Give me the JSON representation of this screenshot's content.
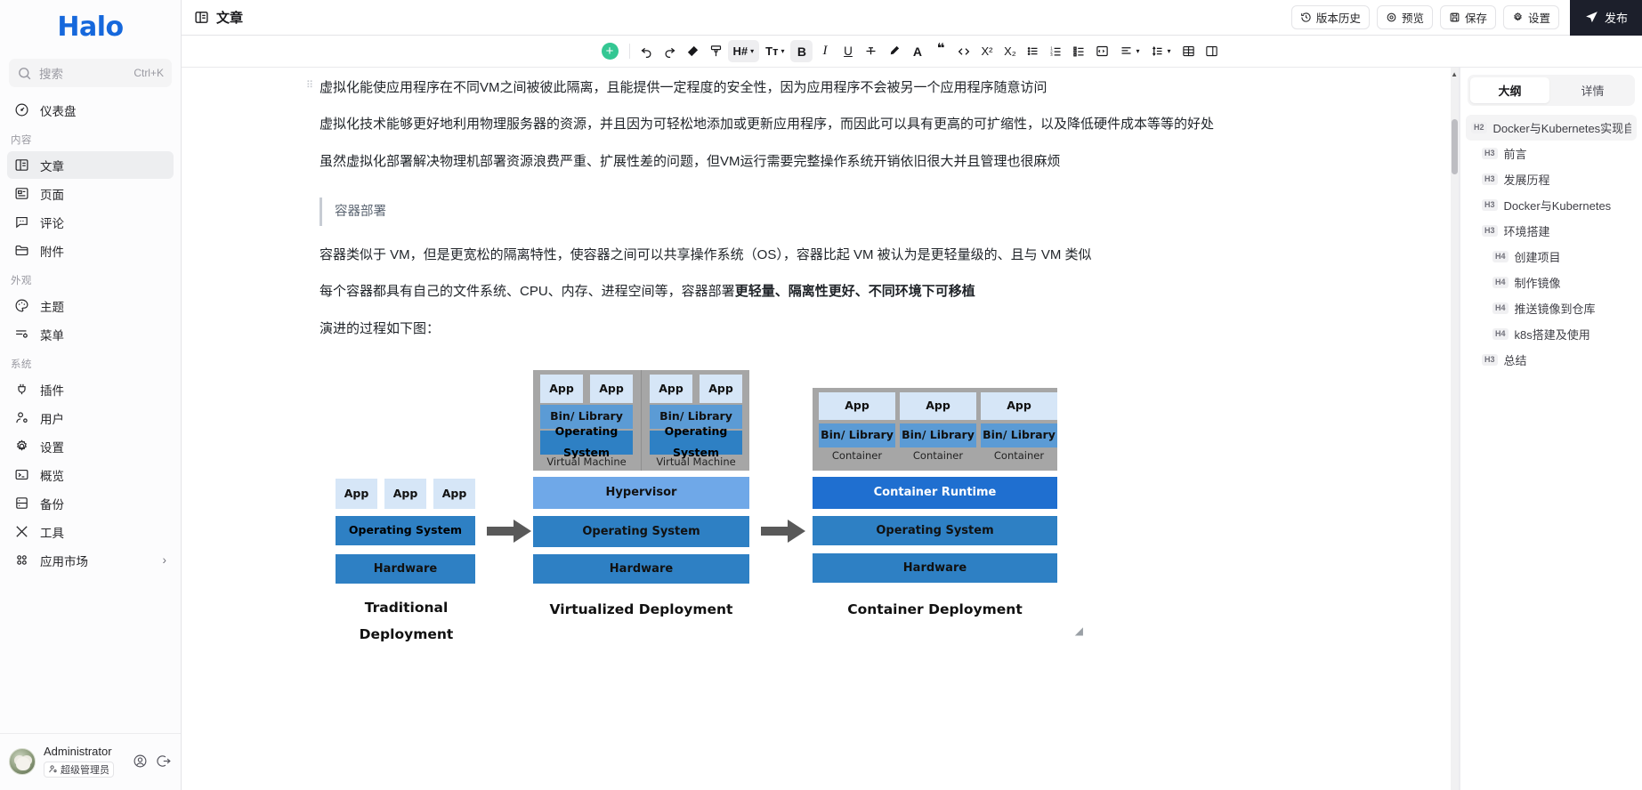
{
  "brand": {
    "name": "Halo"
  },
  "search": {
    "placeholder": "搜索",
    "shortcut": "Ctrl+K"
  },
  "sidebar": {
    "dashboard": {
      "label": "仪表盘",
      "icon": "gauge-icon"
    },
    "groups": [
      {
        "label": "内容",
        "items": [
          {
            "label": "文章",
            "icon": "article-icon",
            "active": true
          },
          {
            "label": "页面",
            "icon": "page-icon",
            "active": false
          },
          {
            "label": "评论",
            "icon": "comment-icon",
            "active": false
          },
          {
            "label": "附件",
            "icon": "folder-icon",
            "active": false
          }
        ]
      },
      {
        "label": "外观",
        "items": [
          {
            "label": "主题",
            "icon": "palette-icon",
            "active": false
          },
          {
            "label": "菜单",
            "icon": "menu-settings-icon",
            "active": false
          }
        ]
      },
      {
        "label": "系统",
        "items": [
          {
            "label": "插件",
            "icon": "plug-icon",
            "active": false
          },
          {
            "label": "用户",
            "icon": "user-gear-icon",
            "active": false
          },
          {
            "label": "设置",
            "icon": "gear-icon",
            "active": false
          },
          {
            "label": "概览",
            "icon": "terminal-icon",
            "active": false
          },
          {
            "label": "备份",
            "icon": "database-icon",
            "active": false
          },
          {
            "label": "工具",
            "icon": "tools-icon",
            "active": false
          },
          {
            "label": "应用市场",
            "icon": "grid-icon",
            "active": false,
            "chevron": "›"
          }
        ]
      }
    ],
    "user": {
      "name": "Administrator",
      "role": "超级管理员",
      "role_icon": "user-role-icon",
      "profile_icon": "user-circle-icon",
      "logout_icon": "logout-icon",
      "avatar_name": "avatar"
    }
  },
  "header": {
    "title": "文章",
    "title_icon": "article-icon",
    "actions": [
      {
        "label": "版本历史",
        "icon": "history-icon"
      },
      {
        "label": "预览",
        "icon": "eye-icon"
      },
      {
        "label": "保存",
        "icon": "save-icon"
      },
      {
        "label": "设置",
        "icon": "gear-icon"
      }
    ],
    "publish": {
      "label": "发布",
      "icon": "send-icon"
    }
  },
  "toolbar": {
    "add_label": "+",
    "items": [
      {
        "name": "undo-icon",
        "glyph": "↶"
      },
      {
        "name": "redo-icon",
        "glyph": "↷"
      },
      {
        "name": "eraser-icon",
        "glyph": "◆"
      },
      {
        "name": "format-painter-icon",
        "glyph": "⊓"
      },
      {
        "name": "heading-dropdown",
        "glyph": "H#",
        "caret": "▾",
        "active": true
      },
      {
        "name": "font-size-dropdown",
        "glyph": "Tᴛ",
        "caret": "▾"
      },
      {
        "name": "bold-icon",
        "glyph": "B",
        "active": true
      },
      {
        "name": "italic-icon",
        "glyph": "I"
      },
      {
        "name": "underline-icon",
        "glyph": "U"
      },
      {
        "name": "strikethrough-icon",
        "glyph": "S"
      },
      {
        "name": "highlight-icon",
        "glyph": "✎"
      },
      {
        "name": "text-color-icon",
        "glyph": "A"
      },
      {
        "name": "quote-icon",
        "glyph": "❝"
      },
      {
        "name": "code-icon",
        "glyph": "<>"
      },
      {
        "name": "superscript-icon",
        "glyph": "X²"
      },
      {
        "name": "subscript-icon",
        "glyph": "X₂"
      },
      {
        "name": "bullet-list-icon",
        "glyph": "≔"
      },
      {
        "name": "ordered-list-icon",
        "glyph": "≔"
      },
      {
        "name": "task-list-icon",
        "glyph": "≔"
      },
      {
        "name": "code-block-icon",
        "glyph": "[]"
      },
      {
        "name": "align-dropdown",
        "glyph": "≡",
        "caret": "▾"
      },
      {
        "name": "line-height-dropdown",
        "glyph": "↕≡",
        "caret": "▾"
      },
      {
        "name": "table-icon",
        "glyph": "▦"
      },
      {
        "name": "columns-icon",
        "glyph": "◫"
      }
    ]
  },
  "document": {
    "paragraphs": [
      "虚拟化能使应用程序在不同VM之间被彼此隔离，且能提供一定程度的安全性，因为应用程序不会被另一个应用程序随意访问",
      "虚拟化技术能够更好地利用物理服务器的资源，并且因为可轻松地添加或更新应用程序，而因此可以具有更高的可扩缩性，以及降低硬件成本等等的好处",
      "虽然虚拟化部署解决物理机部署资源浪费严重、扩展性差的问题，但VM运行需要完整操作系统开销依旧很大并且管理也很麻烦"
    ],
    "blockquote": "容器部署",
    "after_quote": [
      "容器类似于 VM，但是更宽松的隔离特性，使容器之间可以共享操作系统（OS），容器比起 VM 被认为是更轻量级的、且与 VM 类似"
    ],
    "bold_line": {
      "prefix": "每个容器都具有自己的文件系统、CPU、内存、进程空间等，容器部署",
      "bold": "更轻量、隔离性更好、不同环境下可移植"
    },
    "figure_intro": "演进的过程如下图："
  },
  "figure": {
    "columns": [
      {
        "caption": "Traditional Deployment",
        "apps": [
          "App",
          "App",
          "App"
        ],
        "os": "Operating System",
        "hardware": "Hardware"
      },
      {
        "caption": "Virtualized Deployment",
        "vms": [
          {
            "apps": [
              "App",
              "App"
            ],
            "bin": "Bin/ Library",
            "os": "Operating System",
            "label": "Virtual Machine"
          },
          {
            "apps": [
              "App",
              "App"
            ],
            "bin": "Bin/ Library",
            "os": "Operating System",
            "label": "Virtual Machine"
          }
        ],
        "hypervisor": "Hypervisor",
        "os": "Operating System",
        "hardware": "Hardware"
      },
      {
        "caption": "Container Deployment",
        "containers": [
          {
            "app": "App",
            "bin": "Bin/ Library",
            "label": "Container"
          },
          {
            "app": "App",
            "bin": "Bin/ Library",
            "label": "Container"
          },
          {
            "app": "App",
            "bin": "Bin/ Library",
            "label": "Container"
          }
        ],
        "runtime": "Container Runtime",
        "os": "Operating System",
        "hardware": "Hardware"
      }
    ],
    "arrow_glyph": "➡",
    "colors": {
      "app": "#d6e6f7",
      "bin": "#5b9bd5",
      "os": "#2e80c4",
      "gray": "#a6a6a6",
      "hypervisor": "#6fa8e8",
      "runtime": "#1f6fd0",
      "arrow": "#595959"
    }
  },
  "outline": {
    "tabs": [
      {
        "label": "大纲",
        "active": true
      },
      {
        "label": "详情",
        "active": false
      }
    ],
    "items": [
      {
        "tag": "H2",
        "label": "Docker与Kubernetes实现自动",
        "level": "h2"
      },
      {
        "tag": "H3",
        "label": "前言",
        "level": "h3"
      },
      {
        "tag": "H3",
        "label": "发展历程",
        "level": "h3"
      },
      {
        "tag": "H3",
        "label": "Docker与Kubernetes",
        "level": "h3"
      },
      {
        "tag": "H3",
        "label": "环境搭建",
        "level": "h3"
      },
      {
        "tag": "H4",
        "label": "创建项目",
        "level": "h4"
      },
      {
        "tag": "H4",
        "label": "制作镜像",
        "level": "h4"
      },
      {
        "tag": "H4",
        "label": "推送镜像到仓库",
        "level": "h4"
      },
      {
        "tag": "H4",
        "label": "k8s搭建及使用",
        "level": "h4"
      },
      {
        "tag": "H3",
        "label": "总结",
        "level": "h3"
      }
    ]
  },
  "colors": {
    "brand": "#1668dc",
    "accent_green": "#34c793",
    "publish_bg": "#1c1f2b",
    "sidebar_bg": "#fcfcfd"
  }
}
